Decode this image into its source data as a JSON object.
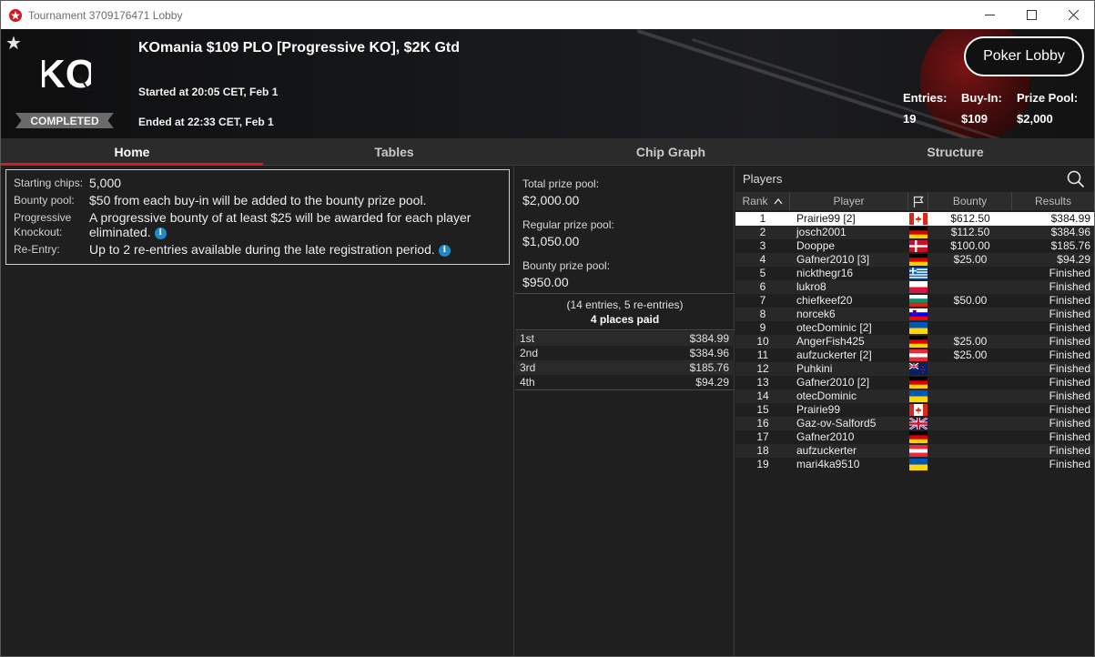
{
  "window": {
    "title": "Tournament 3709176471 Lobby"
  },
  "header": {
    "tournament_name": "KOmania $109 PLO [Progressive KO], $2K Gtd",
    "logo_text": "KO",
    "status_badge": "COMPLETED",
    "started": "Started at 20:05 CET, Feb 1",
    "ended": "Ended at 22:33 CET, Feb 1",
    "poker_lobby_label": "Poker Lobby",
    "stats": {
      "entries_label": "Entries:",
      "entries_value": "19",
      "buyin_label": "Buy-In:",
      "buyin_value": "$109",
      "prizepool_label": "Prize Pool:",
      "prizepool_value": "$2,000"
    }
  },
  "tabs": [
    "Home",
    "Tables",
    "Chip Graph",
    "Structure"
  ],
  "home": {
    "info": [
      {
        "key": "Starting chips:",
        "value": "5,000"
      },
      {
        "key": "Bounty pool:",
        "value": "$50 from each buy-in will be added to the bounty prize pool."
      },
      {
        "key": "Progressive Knockout:",
        "value": "A progressive bounty of at least $25 will be awarded for each player eliminated."
      },
      {
        "key": "Re-Entry:",
        "value": "Up to 2 re-entries available during the late registration period."
      }
    ]
  },
  "prizes": {
    "total_label": "Total prize pool:",
    "total_value": "$2,000.00",
    "regular_label": "Regular prize pool:",
    "regular_value": "$1,050.00",
    "bounty_label": "Bounty prize pool:",
    "bounty_value": "$950.00",
    "entries_note": "(14 entries, 5 re-entries)",
    "places_paid": "4 places paid",
    "payouts": [
      {
        "place": "1st",
        "amount": "$384.99"
      },
      {
        "place": "2nd",
        "amount": "$384.96"
      },
      {
        "place": "3rd",
        "amount": "$185.76"
      },
      {
        "place": "4th",
        "amount": "$94.29"
      }
    ]
  },
  "players": {
    "title": "Players",
    "columns": {
      "rank": "Rank",
      "player": "Player",
      "bounty": "Bounty",
      "results": "Results"
    },
    "rows": [
      {
        "rank": "1",
        "player": "Prairie99 [2]",
        "flag": "ca",
        "bounty": "$612.50",
        "result": "$384.99"
      },
      {
        "rank": "2",
        "player": "josch2001",
        "flag": "de",
        "bounty": "$112.50",
        "result": "$384.96"
      },
      {
        "rank": "3",
        "player": "Dooppe",
        "flag": "dk",
        "bounty": "$100.00",
        "result": "$185.76"
      },
      {
        "rank": "4",
        "player": "Gafner2010 [3]",
        "flag": "de",
        "bounty": "$25.00",
        "result": "$94.29"
      },
      {
        "rank": "5",
        "player": "nickthegr16",
        "flag": "gr",
        "bounty": "",
        "result": "Finished"
      },
      {
        "rank": "6",
        "player": "lukro8",
        "flag": "pl",
        "bounty": "",
        "result": "Finished"
      },
      {
        "rank": "7",
        "player": "chiefkeef20",
        "flag": "bg",
        "bounty": "$50.00",
        "result": "Finished"
      },
      {
        "rank": "8",
        "player": "norcek6",
        "flag": "si",
        "bounty": "",
        "result": "Finished"
      },
      {
        "rank": "9",
        "player": "otecDominic [2]",
        "flag": "ua",
        "bounty": "",
        "result": "Finished"
      },
      {
        "rank": "10",
        "player": "AngerFish425",
        "flag": "de",
        "bounty": "$25.00",
        "result": "Finished"
      },
      {
        "rank": "11",
        "player": "aufzuckerter [2]",
        "flag": "at",
        "bounty": "$25.00",
        "result": "Finished"
      },
      {
        "rank": "12",
        "player": "Puhkini",
        "flag": "nz",
        "bounty": "",
        "result": "Finished"
      },
      {
        "rank": "13",
        "player": "Gafner2010 [2]",
        "flag": "de",
        "bounty": "",
        "result": "Finished"
      },
      {
        "rank": "14",
        "player": "otecDominic",
        "flag": "ua",
        "bounty": "",
        "result": "Finished"
      },
      {
        "rank": "15",
        "player": "Prairie99",
        "flag": "ca",
        "bounty": "",
        "result": "Finished"
      },
      {
        "rank": "16",
        "player": "Gaz-ov-Salford5",
        "flag": "gb",
        "bounty": "",
        "result": "Finished"
      },
      {
        "rank": "17",
        "player": "Gafner2010",
        "flag": "de",
        "bounty": "",
        "result": "Finished"
      },
      {
        "rank": "18",
        "player": "aufzuckerter",
        "flag": "at",
        "bounty": "",
        "result": "Finished"
      },
      {
        "rank": "19",
        "player": "mari4ka9510",
        "flag": "ua",
        "bounty": "",
        "result": "Finished"
      }
    ]
  },
  "colors": {
    "accent": "#d11a23",
    "background": "#1f1f1f",
    "info_icon": "#1f8bc4"
  }
}
